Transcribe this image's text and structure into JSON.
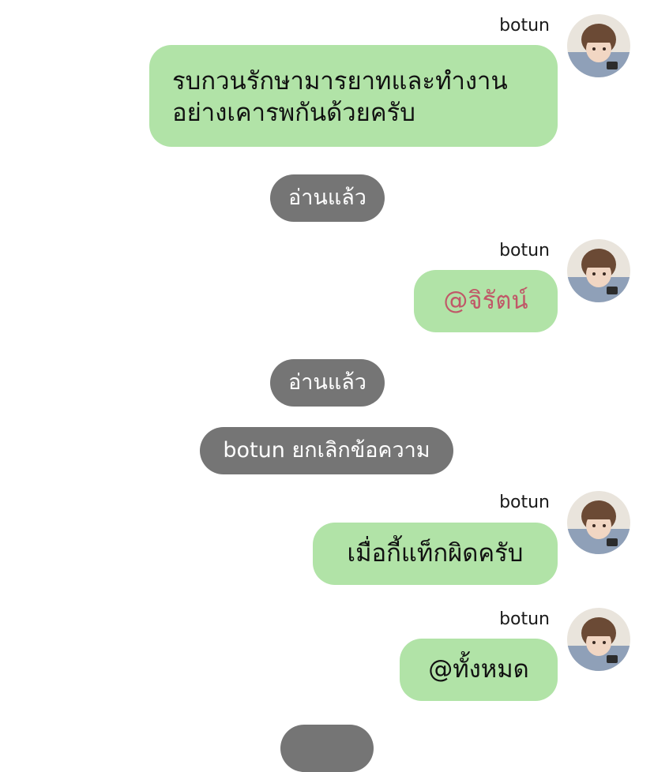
{
  "messages": [
    {
      "sender": "botun",
      "lines": [
        "รบกวนรักษามารยาทและทำงาน",
        "อย่างเคารพกันด้วยครับ"
      ]
    },
    {
      "sender": "botun",
      "text": "@จิรัตน์"
    },
    {
      "sender": "botun",
      "text": "เมื่อกี้แท็กผิดครับ"
    },
    {
      "sender": "botun",
      "text": "@ทั้งหมด"
    }
  ],
  "system": {
    "read_1": "อ่านแล้ว",
    "read_2": "อ่านแล้ว",
    "unsent": "botun ยกเลิกข้อความ"
  },
  "colors": {
    "bubble_green": "#b1e3a7",
    "mention_text": "#c05868",
    "system_pill": "#757575"
  }
}
